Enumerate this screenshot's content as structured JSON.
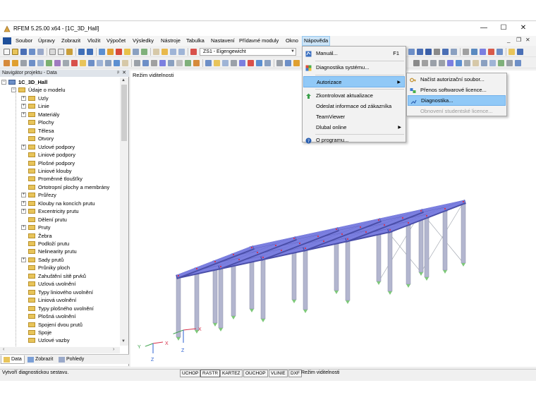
{
  "window": {
    "title": "RFEM 5.25.00 x64 - [1C_3D_Hall]",
    "controls": {
      "minimize": "—",
      "maximize": "☐",
      "close": "✕"
    }
  },
  "menubar": {
    "items": [
      "Soubor",
      "Úpravy",
      "Zobrazit",
      "Vložit",
      "Výpočet",
      "Výsledky",
      "Nástroje",
      "Tabulka",
      "Nastavení",
      "Přídavné moduly",
      "Okno",
      "Nápověda"
    ],
    "active": "Nápověda",
    "child_controls": {
      "minimize": "_",
      "restore": "❐",
      "close": "✕"
    }
  },
  "toolbar": {
    "loadcase": "ZS1 - Eigengewicht"
  },
  "navigator": {
    "title": "Navigátor projektu - Data",
    "pin": "ᵖ",
    "close": "✕",
    "tree": [
      {
        "label": "1C_3D_Hall",
        "level": 0,
        "exp": "−",
        "bold": true
      },
      {
        "label": "Údaje o modelu",
        "level": 1,
        "exp": "−"
      },
      {
        "label": "Uzly",
        "level": 2,
        "exp": "+"
      },
      {
        "label": "Linie",
        "level": 2,
        "exp": "+"
      },
      {
        "label": "Materiály",
        "level": 2,
        "exp": "+"
      },
      {
        "label": "Plochy",
        "level": 2,
        "exp": ""
      },
      {
        "label": "Tělesa",
        "level": 2,
        "exp": ""
      },
      {
        "label": "Otvory",
        "level": 2,
        "exp": ""
      },
      {
        "label": "Uzlové podpory",
        "level": 2,
        "exp": "+"
      },
      {
        "label": "Liniové podpory",
        "level": 2,
        "exp": ""
      },
      {
        "label": "Plošné podpory",
        "level": 2,
        "exp": ""
      },
      {
        "label": "Liniové klouby",
        "level": 2,
        "exp": ""
      },
      {
        "label": "Proměnné tloušťky",
        "level": 2,
        "exp": ""
      },
      {
        "label": "Ortotropní plochy a membrány",
        "level": 2,
        "exp": ""
      },
      {
        "label": "Průřezy",
        "level": 2,
        "exp": "+"
      },
      {
        "label": "Klouby na koncích prutu",
        "level": 2,
        "exp": "+"
      },
      {
        "label": "Excentricity prutu",
        "level": 2,
        "exp": "+"
      },
      {
        "label": "Dělení prutu",
        "level": 2,
        "exp": ""
      },
      {
        "label": "Pruty",
        "level": 2,
        "exp": "+"
      },
      {
        "label": "Žebra",
        "level": 2,
        "exp": ""
      },
      {
        "label": "Podloží prutu",
        "level": 2,
        "exp": ""
      },
      {
        "label": "Nelinearity prutu",
        "level": 2,
        "exp": ""
      },
      {
        "label": "Sady prutů",
        "level": 2,
        "exp": "+"
      },
      {
        "label": "Průniky ploch",
        "level": 2,
        "exp": ""
      },
      {
        "label": "Zahuštění sítě prvků",
        "level": 2,
        "exp": ""
      },
      {
        "label": "Uzlová uvolnění",
        "level": 2,
        "exp": ""
      },
      {
        "label": "Typy liniového uvolnění",
        "level": 2,
        "exp": ""
      },
      {
        "label": "Liniová uvolnění",
        "level": 2,
        "exp": ""
      },
      {
        "label": "Typy plošného uvolnění",
        "level": 2,
        "exp": ""
      },
      {
        "label": "Plošná uvolnění",
        "level": 2,
        "exp": ""
      },
      {
        "label": "Spojení dvou prutů",
        "level": 2,
        "exp": ""
      },
      {
        "label": "Spoje",
        "level": 2,
        "exp": ""
      },
      {
        "label": "Uzlové vazby",
        "level": 2,
        "exp": ""
      }
    ],
    "tabs": [
      "Data",
      "Zobrazit",
      "Pohledy"
    ],
    "active_tab": "Data",
    "scroll_left": "‹",
    "scroll_right": "›",
    "scroll_up": "▲",
    "scroll_down": "▼"
  },
  "viewport": {
    "label": "Režim viditelnosti",
    "axes": {
      "x": "X",
      "y": "Y",
      "z": "Z"
    }
  },
  "statusbar": {
    "message": "Vytvoří diagnostickou sestavu.",
    "buttons": [
      "UCHOP",
      "RASTR",
      "KARTEZ",
      "OUCHOP",
      "VLINIE",
      "DXF"
    ],
    "active": "RASTR",
    "mode": "Režim viditelnosti"
  },
  "help_menu": {
    "items": [
      {
        "label": "Manuál...",
        "shortcut": "F1"
      },
      {
        "label": "Diagnostika systému..."
      },
      {
        "label": "Autorizace",
        "submenu": "▶"
      },
      {
        "label": "Zkontrolovat aktualizace"
      },
      {
        "label": "Odeslat informace od zákazníka"
      },
      {
        "label": "TeamViewer"
      },
      {
        "label": "Dlubal online",
        "submenu": "▶"
      },
      {
        "label": "O programu..."
      }
    ]
  },
  "auth_submenu": {
    "items": [
      {
        "label": "Načíst autorizační soubor..."
      },
      {
        "label": "Přenos softwarové licence..."
      },
      {
        "label": "Diagnostika..."
      },
      {
        "label": "Obnovení studentské licence..."
      }
    ]
  },
  "colors": {
    "beam": "#7b7fe0",
    "column": "#b3b6cf",
    "support": "#7ec87a",
    "highlight": "#91c9f7"
  }
}
